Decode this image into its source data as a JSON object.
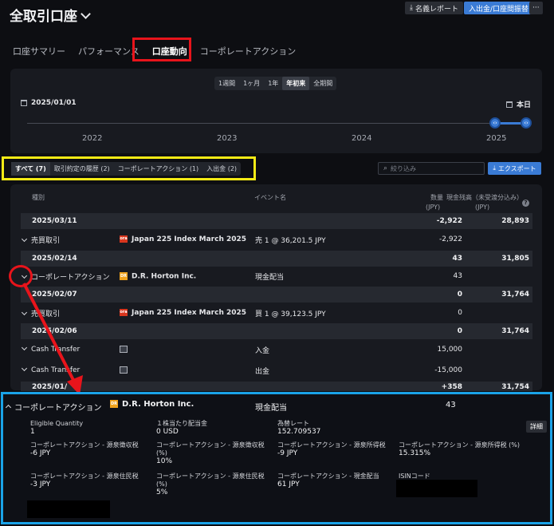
{
  "header": {
    "title": "全取引口座",
    "statement_button": "名義レポート",
    "deposit_button": "入出金/口座間振替",
    "more_label": "···"
  },
  "tabs": [
    {
      "label": "口座サマリー"
    },
    {
      "label": "パフォーマンス"
    },
    {
      "label": "口座動向"
    },
    {
      "label": "コーポレートアクション"
    }
  ],
  "range": {
    "options": [
      "1週間",
      "1ヶ月",
      "1年",
      "年初来",
      "全期間"
    ],
    "active": "年初来",
    "start_date": "2025/01/01",
    "end_label": "本日",
    "years": [
      "2022",
      "2023",
      "2024",
      "2025"
    ]
  },
  "filters": [
    {
      "label": "すべて (7)"
    },
    {
      "label": "取引約定の履歴 (2)"
    },
    {
      "label": "コーポレートアクション (1)"
    },
    {
      "label": "入出金 (2)"
    }
  ],
  "search": {
    "placeholder": "絞り込み"
  },
  "export_label": "エクスポート",
  "table": {
    "headers": {
      "type": "種別",
      "event": "イベント名",
      "qty": "数量",
      "qty_unit": "(JPY)",
      "cash": "現金残高（未受渡分込み）",
      "cash_unit": "(JPY)"
    },
    "rows": [
      {
        "kind": "date",
        "date": "2025/03/11",
        "qty": "-2,922",
        "cash": "28,893"
      },
      {
        "kind": "item",
        "type": "売買取引",
        "instrument": "Japan 225 Index March 2025",
        "icon": "ora",
        "event": "売 1 @ 36,201.5 JPY",
        "qty": "-2,922",
        "cash": ""
      },
      {
        "kind": "date",
        "date": "2025/02/14",
        "qty": "43",
        "cash": "31,805"
      },
      {
        "kind": "item",
        "type": "コーポレートアクション",
        "instrument": "D.R. Horton Inc.",
        "icon": "dr",
        "event": "現金配当",
        "qty": "43",
        "cash": ""
      },
      {
        "kind": "date",
        "date": "2025/02/07",
        "qty": "0",
        "cash": "31,764"
      },
      {
        "kind": "item",
        "type": "売買取引",
        "instrument": "Japan 225 Index March 2025",
        "icon": "ora",
        "event": "買 1 @ 39,123.5 JPY",
        "qty": "0",
        "cash": ""
      },
      {
        "kind": "date",
        "date": "2025/02/06",
        "qty": "0",
        "cash": "31,764"
      },
      {
        "kind": "item",
        "type": "Cash Transfer",
        "instrument": "",
        "icon": "img",
        "event": "入金",
        "qty": "15,000",
        "cash": ""
      },
      {
        "kind": "item",
        "type": "Cash Transfer",
        "instrument": "",
        "icon": "img",
        "event": "出金",
        "qty": "-15,000",
        "cash": ""
      },
      {
        "kind": "date",
        "date": "2025/01/",
        "qty": "+358",
        "cash": "31,754"
      }
    ]
  },
  "detail": {
    "type": "コーポレートアクション",
    "instrument": "D.R. Horton Inc.",
    "event": "現金配当",
    "qty": "43",
    "details_button": "詳細",
    "fields": [
      {
        "label": "Eligible Quantity",
        "value": "1"
      },
      {
        "label": "１株当たり配当金",
        "value": "0 USD"
      },
      {
        "label": "為替レート",
        "value": "152.709537"
      },
      {
        "label": "コーポレートアクション - 源泉徴収税",
        "value": "-6 JPY"
      },
      {
        "label": "コーポレートアクション - 源泉徴収税 (%)",
        "value": "10%"
      },
      {
        "label": "コーポレートアクション - 源泉所得税",
        "value": "-9 JPY"
      },
      {
        "label": "コーポレートアクション - 源泉所得税 (%)",
        "value": "15.315%"
      },
      {
        "label": "コーポレートアクション - 源泉住民税",
        "value": "-3 JPY"
      },
      {
        "label": "コーポレートアクション - 源泉住民税 (%)",
        "value": "5%"
      },
      {
        "label": "コーポレートアクション - 現金配当",
        "value": "61 JPY"
      },
      {
        "label": "ISINコード",
        "value": ""
      }
    ]
  },
  "colors": {
    "accent": "#3a7bd5",
    "highlight_red": "#e8141b",
    "highlight_yellow": "#f4ea15",
    "highlight_blue": "#1aa3e8"
  }
}
